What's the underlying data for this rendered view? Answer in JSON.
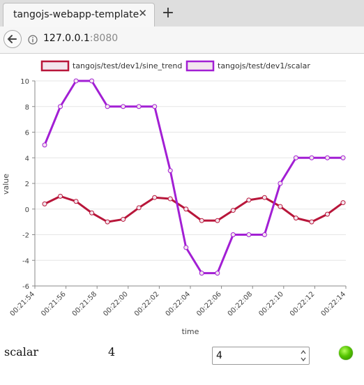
{
  "browser": {
    "tab_title": "tangojs-webapp-template",
    "tab_close_icon": "close-icon",
    "new_tab_icon": "plus-icon",
    "url_host": "127.0.0.1",
    "url_port": ":8080"
  },
  "widget": {
    "label": "scalar",
    "value": "4",
    "input_value": "4",
    "led_color": "#55c400"
  },
  "chart_data": {
    "type": "line",
    "xlabel": "time",
    "ylabel": "value",
    "ylim": [
      -6,
      10
    ],
    "yticks": [
      "10",
      "8",
      "6",
      "4",
      "2",
      "0",
      "-2",
      "-4",
      "-6"
    ],
    "xticks": [
      "00:21:54",
      "00:21:56",
      "00:21:58",
      "00:22:00",
      "00:22:02",
      "00:22:04",
      "00:22:06",
      "00:22:08",
      "00:22:10",
      "00:22:12",
      "00:22:14"
    ],
    "grid": true,
    "legend_position": "top",
    "series": [
      {
        "name": "tangojs/test/dev1/sine_trend",
        "color": "#b8163a",
        "values": [
          0.4,
          1.0,
          0.6,
          -0.3,
          -1.0,
          -0.8,
          0.1,
          0.9,
          0.8,
          0.0,
          -0.9,
          -0.9,
          -0.1,
          0.7,
          0.9,
          0.2,
          -0.7,
          -1.0,
          -0.4,
          0.5
        ]
      },
      {
        "name": "tangojs/test/dev1/scalar",
        "color": "#a21fd4",
        "values": [
          5,
          8,
          10,
          10,
          8,
          8,
          8,
          8,
          3,
          -3,
          -5,
          -5,
          -2,
          -2,
          -2,
          2,
          4,
          4,
          4,
          4
        ]
      }
    ]
  }
}
